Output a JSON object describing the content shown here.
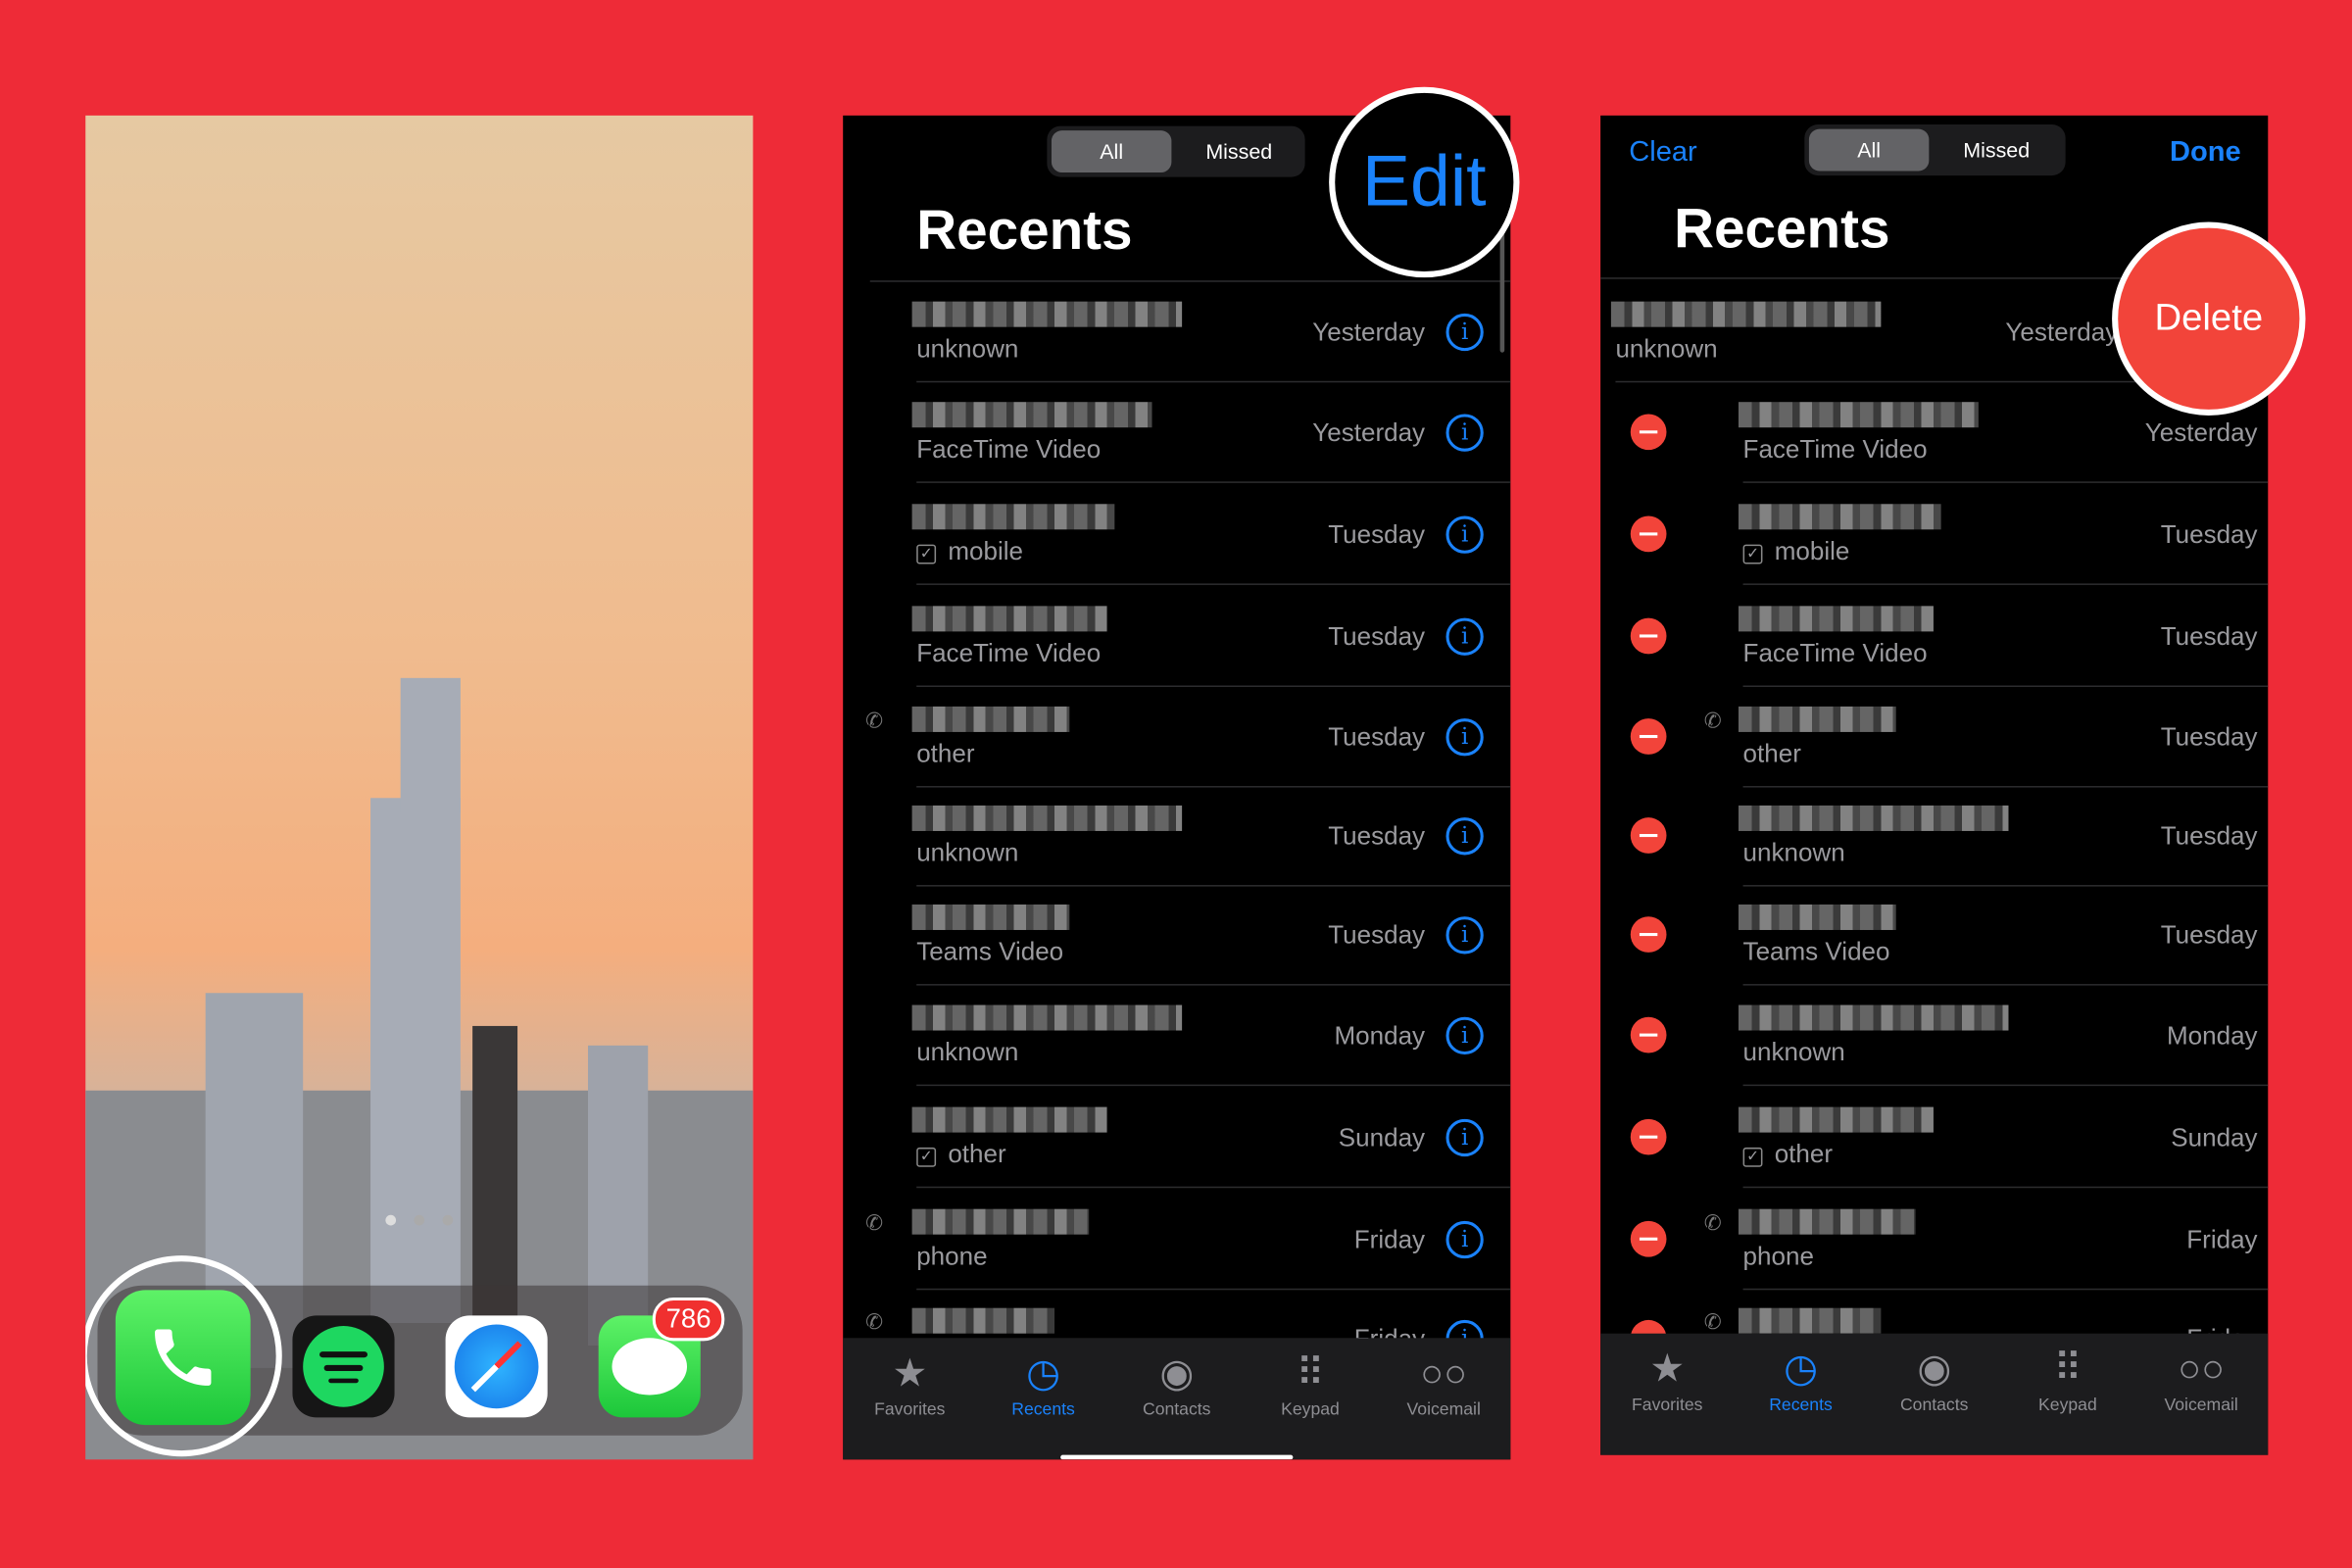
{
  "home": {
    "page_dots": 3,
    "dock_apps": [
      {
        "name": "Phone",
        "icon": "phone-icon",
        "highlighted": true
      },
      {
        "name": "Spotify",
        "icon": "spotify-icon"
      },
      {
        "name": "Safari",
        "icon": "compass-icon"
      },
      {
        "name": "Messages",
        "icon": "message-bubble-icon",
        "badge": "786"
      }
    ]
  },
  "recents_view": {
    "segments": [
      "All",
      "Missed"
    ],
    "selected_segment": "All",
    "edit_label": "Edit",
    "title": "Recents",
    "rows": [
      {
        "sub": "unknown",
        "date": "Yesterday"
      },
      {
        "sub": "FaceTime Video",
        "date": "Yesterday"
      },
      {
        "sub": "mobile",
        "date": "Tuesday",
        "checkbox": true
      },
      {
        "sub": "FaceTime Video",
        "date": "Tuesday"
      },
      {
        "sub": "other",
        "date": "Tuesday",
        "outgoing": true
      },
      {
        "sub": "unknown",
        "date": "Tuesday"
      },
      {
        "sub": "Teams Video",
        "date": "Tuesday"
      },
      {
        "sub": "unknown",
        "date": "Monday"
      },
      {
        "sub": "other",
        "date": "Sunday",
        "checkbox": true
      },
      {
        "sub": "phone",
        "date": "Friday",
        "outgoing": true
      },
      {
        "sub": "",
        "date": "Friday",
        "outgoing": true
      }
    ]
  },
  "edit_view": {
    "clear_label": "Clear",
    "done_label": "Done",
    "delete_label": "Delete",
    "segments": [
      "All",
      "Missed"
    ],
    "title": "Recents"
  },
  "tabbar": [
    {
      "label": "Favorites",
      "icon": "star-icon"
    },
    {
      "label": "Recents",
      "icon": "clock-icon",
      "active": true
    },
    {
      "label": "Contacts",
      "icon": "person-circle-icon"
    },
    {
      "label": "Keypad",
      "icon": "keypad-icon"
    },
    {
      "label": "Voicemail",
      "icon": "voicemail-icon"
    }
  ],
  "colors": {
    "background": "#ee2b37",
    "accent": "#1a82fb",
    "delete": "#f2443a"
  }
}
